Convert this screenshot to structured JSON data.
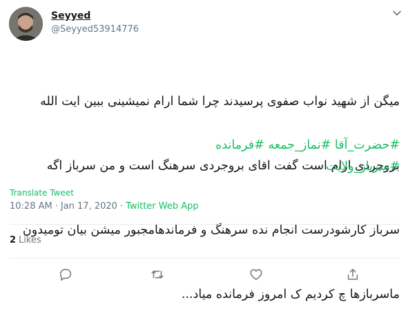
{
  "user": {
    "display_name": "Seyyed",
    "handle": "@Seyyed53914776"
  },
  "tweet": {
    "lines": [
      "میگن از شهید نواب صفوی پرسیدند چرا شما ارام نمیشینی ببین ایت الله",
      "بروجردی ارام است گفت اقای بروجردی سرهنگ است و من سرباز اگه",
      "سرباز کارشودرست انجام نده سرهنگ و فرماندهامجبور میشن بیان تومیدون",
      "ماسربازها چ کردیم ک امروز فرمانده میاد..."
    ],
    "hashtags_line1": [
      "#حضرت_آقا",
      "#نماز_جمعه",
      "#فرمانده"
    ],
    "hashtags_line2": [
      "#سرباز_ولایت"
    ]
  },
  "translate_label": "Translate Tweet",
  "meta": {
    "time": "10:28 AM",
    "date": "Jan 17, 2020",
    "separator": "·",
    "app": "Twitter Web App"
  },
  "stats": {
    "likes_count": "2",
    "likes_label": "Likes"
  },
  "icons": {
    "caret": "chevron-down-icon",
    "reply": "reply-icon",
    "retweet": "retweet-icon",
    "like": "heart-icon",
    "share": "share-icon"
  },
  "colors": {
    "accent": "#17bf63",
    "text": "#14171a",
    "secondary": "#657786",
    "divider": "#e6ecf0"
  }
}
